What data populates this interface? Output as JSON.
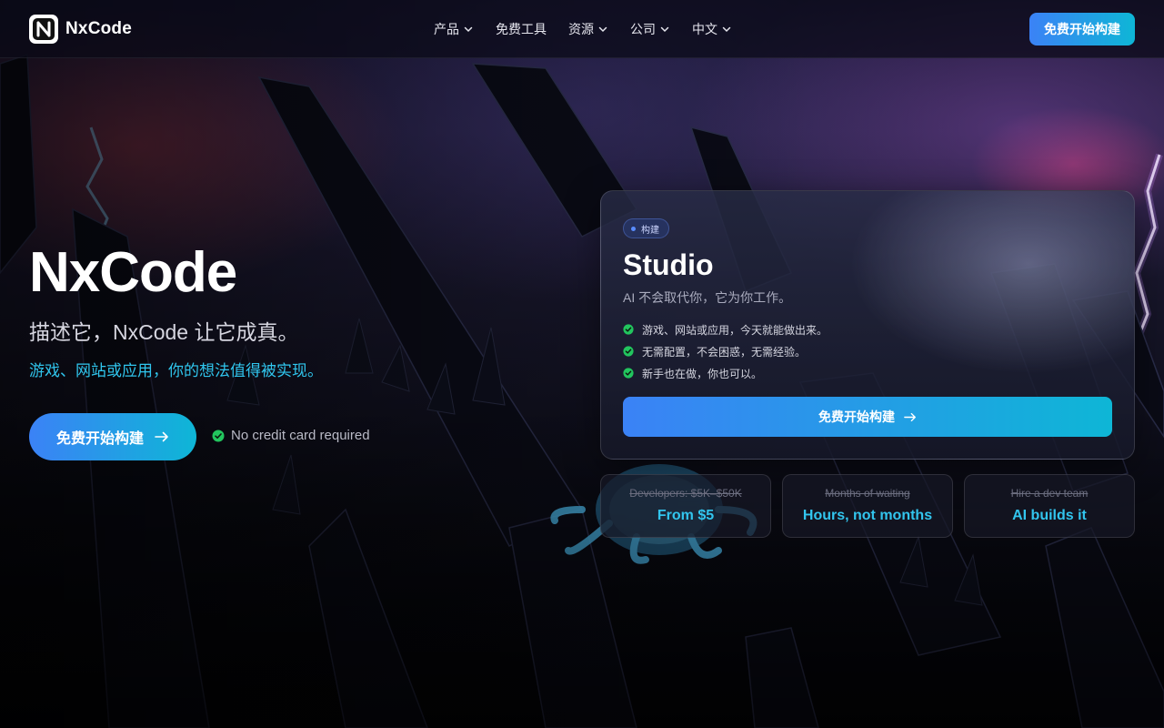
{
  "brand": {
    "name": "NxCode",
    "logo_icon": "nx-logo-icon"
  },
  "nav": {
    "items": [
      {
        "label": "产品",
        "has_dropdown": true
      },
      {
        "label": "免费工具",
        "has_dropdown": false
      },
      {
        "label": "资源",
        "has_dropdown": true
      },
      {
        "label": "公司",
        "has_dropdown": true
      },
      {
        "label": "中文",
        "has_dropdown": true
      }
    ],
    "cta_label": "免费开始构建"
  },
  "hero": {
    "title": "NxCode",
    "subtitle": "描述它，NxCode 让它成真。",
    "tagline": "游戏、网站或应用，你的想法值得被实现。",
    "cta_label": "免费开始构建",
    "note": "No credit card required"
  },
  "card": {
    "badge": "构建",
    "title": "Studio",
    "subtitle": "AI 不会取代你，它为你工作。",
    "features": [
      "游戏、网站或应用，今天就能做出来。",
      "无需配置，不会困惑，无需经验。",
      "新手也在做，你也可以。"
    ],
    "cta_label": "免费开始构建"
  },
  "stats": [
    {
      "old": "Developers: $5K–$50K",
      "new": "From $5"
    },
    {
      "old": "Months of waiting",
      "new": "Hours, not months"
    },
    {
      "old": "Hire a dev team",
      "new": "AI builds it"
    }
  ],
  "colors": {
    "accent_start": "#3b82f6",
    "accent_end": "#0eb6d6",
    "accent_text": "#30c6ee",
    "check_green": "#22c55e",
    "background": "#05060d"
  }
}
